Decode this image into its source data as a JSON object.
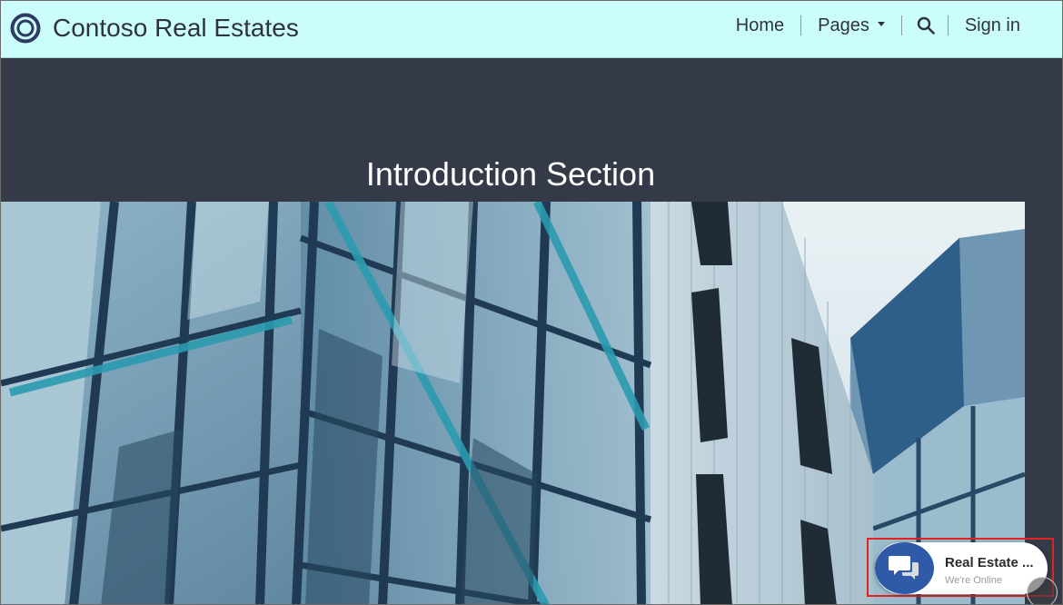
{
  "header": {
    "brand": "Contoso Real Estates",
    "logo_icon": "ring-logo-icon",
    "nav": {
      "home": "Home",
      "pages": "Pages",
      "search_icon": "search-icon",
      "sign_in": "Sign in"
    }
  },
  "hero": {
    "title": "Introduction Section",
    "image_subject": "modern glass office building facade"
  },
  "chat": {
    "title": "Real Estate ...",
    "status": "We're Online",
    "icon": "chat-bubbles-icon"
  },
  "colors": {
    "header_bg": "#ccfdfd",
    "hero_bg": "#343a48",
    "chat_accent": "#2e5aa8",
    "highlight_border": "#e02424"
  }
}
